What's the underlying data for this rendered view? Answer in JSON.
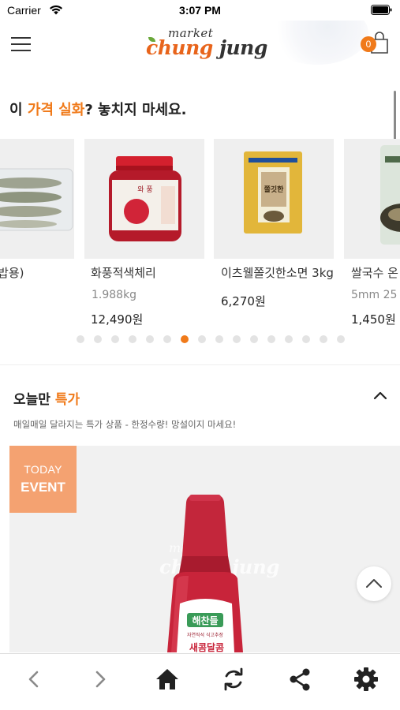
{
  "status_bar": {
    "carrier": "Carrier",
    "time": "3:07 PM"
  },
  "header": {
    "logo_market": "market",
    "logo_chung": "chung",
    "logo_jung": "jung",
    "cart_count": "0"
  },
  "section_deals": {
    "title_part1": "이 ",
    "title_accent": "가격 실화",
    "title_part2": "? 놓치지 마세요.",
    "products": [
      {
        "name": ":밥용)",
        "weight": "",
        "price": ""
      },
      {
        "name": "화풍적색체리",
        "weight": "1.988kg",
        "price": "12,490원"
      },
      {
        "name": "이츠웰쫄깃한소면 3kg",
        "weight": "",
        "price": "6,270원"
      },
      {
        "name": "쌀국수 온",
        "weight": "5mm 25",
        "price": "1,450원"
      }
    ],
    "product_images": {
      "p1_label": "",
      "p2_label": "와 풍",
      "p3_label": "쫄깃한"
    },
    "pagination": {
      "total": 16,
      "active_index": 6
    }
  },
  "section_today": {
    "title_part1": "오늘만 ",
    "title_accent": "특가",
    "subtitle": "매일매일 달라지는 특가 상품 - 한정수량! 망설이지 마세요!",
    "badge_line1": "TODAY",
    "badge_line2": "EVENT",
    "watermark_line1": "market",
    "watermark_line2": "chung jung",
    "bottle_brand": "해찬들",
    "bottle_subtext": "자연직석 식고추장",
    "bottle_product": "새콤달콤"
  },
  "colors": {
    "accent": "#f07a1a",
    "badge": "#f4a271",
    "bottle_red": "#c8243a"
  }
}
